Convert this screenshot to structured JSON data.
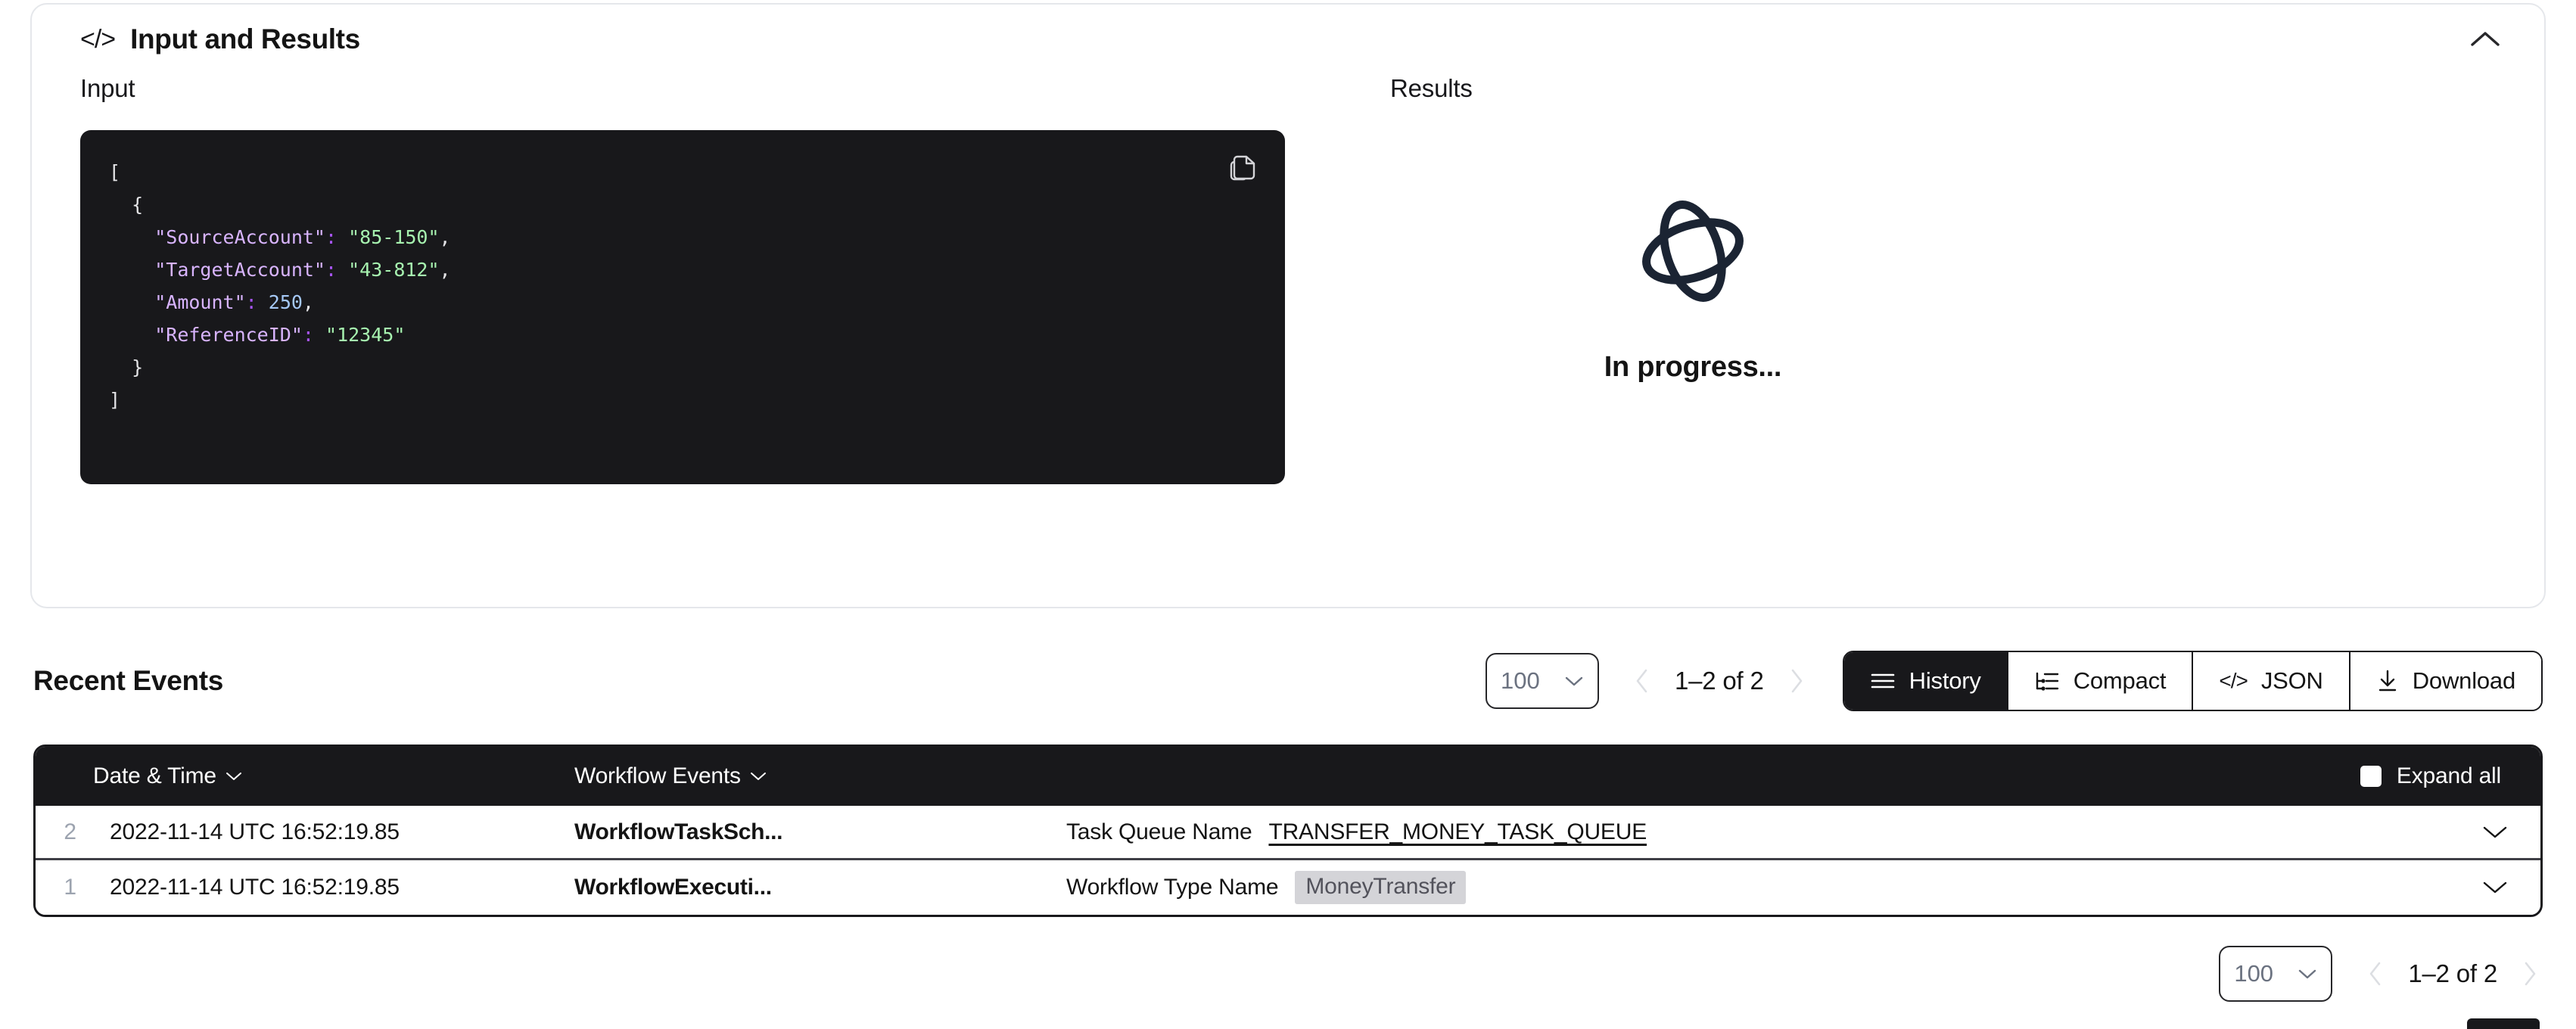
{
  "io_section": {
    "title": "Input and Results",
    "code_icon": "code-brackets-icon",
    "collapse_icon": "chevron-up-icon",
    "input_label": "Input",
    "results_label": "Results",
    "copy_icon": "copy-icon",
    "input_code_lines": [
      {
        "indent": 0,
        "tokens": [
          {
            "t": "punct",
            "v": "["
          }
        ]
      },
      {
        "indent": 1,
        "tokens": [
          {
            "t": "punct",
            "v": "{"
          }
        ]
      },
      {
        "indent": 2,
        "tokens": [
          {
            "t": "key",
            "v": "\"SourceAccount\""
          },
          {
            "t": "colon",
            "v": ":"
          },
          {
            "t": "punct",
            "v": " "
          },
          {
            "t": "str",
            "v": "\"85-150\""
          },
          {
            "t": "punct",
            "v": ","
          }
        ]
      },
      {
        "indent": 2,
        "tokens": [
          {
            "t": "key",
            "v": "\"TargetAccount\""
          },
          {
            "t": "colon",
            "v": ":"
          },
          {
            "t": "punct",
            "v": " "
          },
          {
            "t": "str",
            "v": "\"43-812\""
          },
          {
            "t": "punct",
            "v": ","
          }
        ]
      },
      {
        "indent": 2,
        "tokens": [
          {
            "t": "key",
            "v": "\"Amount\""
          },
          {
            "t": "colon",
            "v": ":"
          },
          {
            "t": "punct",
            "v": " "
          },
          {
            "t": "num",
            "v": "250"
          },
          {
            "t": "punct",
            "v": ","
          }
        ]
      },
      {
        "indent": 2,
        "tokens": [
          {
            "t": "key",
            "v": "\"ReferenceID\""
          },
          {
            "t": "colon",
            "v": ":"
          },
          {
            "t": "punct",
            "v": " "
          },
          {
            "t": "str",
            "v": "\"12345\""
          }
        ]
      },
      {
        "indent": 1,
        "tokens": [
          {
            "t": "punct",
            "v": "}"
          }
        ]
      },
      {
        "indent": 0,
        "tokens": [
          {
            "t": "punct",
            "v": "]"
          }
        ]
      }
    ],
    "results_status": "In progress...",
    "results_icon": "temporal-logo-icon"
  },
  "events": {
    "title": "Recent Events",
    "page_size": {
      "value": "100",
      "chevron_icon": "chevron-down-icon"
    },
    "pager": {
      "prev_icon": "chevron-left-icon",
      "next_icon": "chevron-right-icon",
      "range_label": "1–2 of 2"
    },
    "view_modes": [
      {
        "label": "History",
        "icon": "hamburger-lines-icon",
        "active": true
      },
      {
        "label": "Compact",
        "icon": "tree-list-icon",
        "active": false
      },
      {
        "label": "JSON",
        "icon": "code-brackets-icon",
        "active": false
      },
      {
        "label": "Download",
        "icon": "download-arrow-icon",
        "active": false
      }
    ],
    "table": {
      "columns": {
        "index": "",
        "date": "Date & Time",
        "date_sort_icon": "chevron-down-icon",
        "event": "Workflow Events",
        "event_sort_icon": "chevron-down-icon",
        "expand_all": "Expand all",
        "expand_all_checked": false
      },
      "rows": [
        {
          "index": "2",
          "date": "2022-11-14 UTC 16:52:19.85",
          "event": "WorkflowTaskSch...",
          "detail_label": "Task Queue Name",
          "detail_value": "TRANSFER_MONEY_TASK_QUEUE",
          "detail_kind": "link",
          "expand_icon": "chevron-down-icon"
        },
        {
          "index": "1",
          "date": "2022-11-14 UTC 16:52:19.85",
          "event": "WorkflowExecuti...",
          "detail_label": "Workflow Type Name",
          "detail_value": "MoneyTransfer",
          "detail_kind": "badge",
          "expand_icon": "chevron-down-icon"
        }
      ]
    },
    "bottom_pager": {
      "page_size_value": "100",
      "page_size_chevron_icon": "chevron-down-icon",
      "prev_icon": "chevron-left-icon",
      "next_icon": "chevron-right-icon",
      "range_label": "1–2 of 2"
    }
  },
  "colors": {
    "surface": "#ffffff",
    "ink": "#141414",
    "dark": "#18181b",
    "border_light": "#e5e7eb",
    "muted": "#6b7280",
    "row_divider": "#3f3f46",
    "badge_bg": "#d4d4d8",
    "code_key": "#d8b4fe",
    "code_string": "#a7f3b0",
    "code_number": "#a5c8f5",
    "code_colon": "#a855f7"
  }
}
